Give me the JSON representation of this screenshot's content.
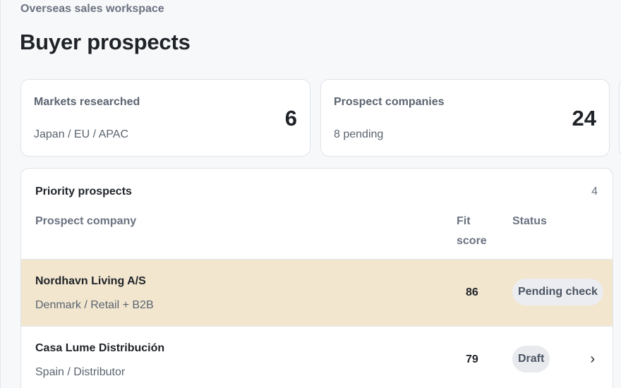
{
  "header": {
    "workspace": "Overseas sales workspace",
    "title": "Buyer prospects"
  },
  "stats": [
    {
      "label": "Markets researched",
      "sub": "Japan / EU / APAC",
      "value": "6"
    },
    {
      "label": "Prospect companies",
      "sub": "8 pending",
      "value": "24"
    }
  ],
  "panel": {
    "title": "Priority prospects",
    "count": "4",
    "columns": {
      "company": "Prospect company",
      "fit": "Fit score",
      "status": "Status"
    },
    "rows": [
      {
        "name": "Nordhavn Living A/S",
        "meta": "Denmark / Retail + B2B",
        "score": "86",
        "status": "Pending check",
        "highlighted": true
      },
      {
        "name": "Casa Lume Distribución",
        "meta": "Spain / Distributor",
        "score": "79",
        "status": "Draft",
        "chevron": "›"
      }
    ]
  },
  "colors": {
    "highlight_row": "#f2e6cf",
    "badge_bg": "#e8eaee"
  }
}
